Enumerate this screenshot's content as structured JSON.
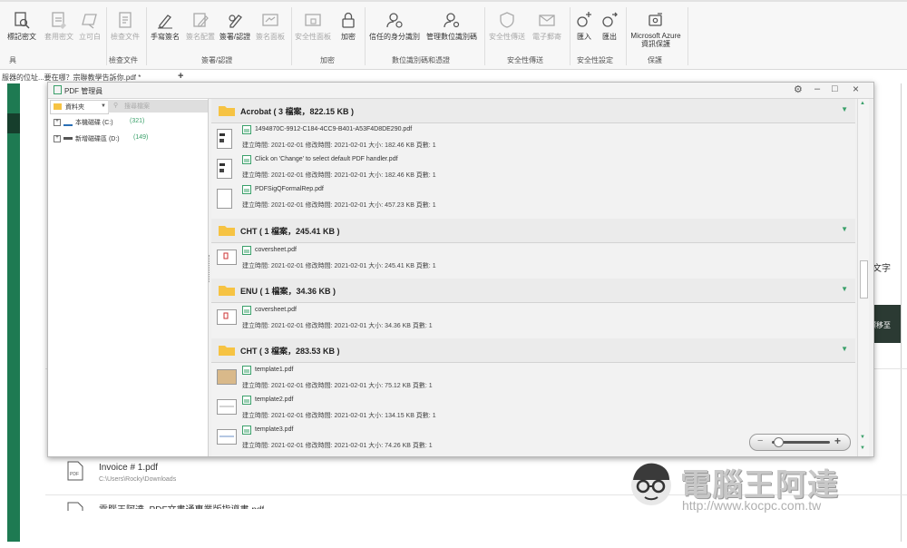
{
  "ribbon": {
    "buttons": [
      {
        "label": "標記密文",
        "icon": "mark-redact-icon",
        "disabled": false
      },
      {
        "label": "套用密文",
        "icon": "apply-redact-icon",
        "disabled": true
      },
      {
        "label": "立可白",
        "icon": "whiteout-icon",
        "disabled": true
      },
      {
        "label": "檢查文件",
        "icon": "inspect-document-icon",
        "disabled": true
      },
      {
        "label": "手寫簽名",
        "icon": "handwrite-sign-icon",
        "disabled": false
      },
      {
        "label": "簽名配置",
        "icon": "signature-config-icon",
        "disabled": true
      },
      {
        "label": "簽署/認證",
        "icon": "sign-certify-icon",
        "disabled": false
      },
      {
        "label": "簽名面板",
        "icon": "signature-panel-icon",
        "disabled": true
      },
      {
        "label": "安全性面板",
        "icon": "security-panel-icon",
        "disabled": true
      },
      {
        "label": "加密",
        "icon": "encrypt-icon",
        "disabled": false
      },
      {
        "label": "信任的身分識別",
        "icon": "trusted-identity-icon",
        "disabled": false
      },
      {
        "label": "管理數位識別碼",
        "icon": "manage-digital-id-icon",
        "disabled": false
      },
      {
        "label": "安全性傳送",
        "icon": "secure-send-icon",
        "disabled": true
      },
      {
        "label": "電子郵寄",
        "icon": "email-icon",
        "disabled": true
      },
      {
        "label": "匯入",
        "icon": "import-icon",
        "disabled": false
      },
      {
        "label": "匯出",
        "icon": "export-icon",
        "disabled": false
      },
      {
        "label": "Microsoft Azure",
        "label2": "資訊保護",
        "icon": "azure-protect-icon",
        "disabled": false
      }
    ],
    "groups": [
      "具",
      "檢查文件",
      "簽署/認證",
      "加密",
      "數位識別碼和憑證",
      "安全性傳送",
      "安全性設定",
      "保護"
    ]
  },
  "doc_tab": {
    "label": "服器的位址...要在哪？宗聯教學告訴你.pdf *",
    "add": "+"
  },
  "background": {
    "right_text": "文字",
    "right_dark_text": "標移至",
    "recent_files": [
      {
        "name": "Invoice # 1.pdf",
        "path": "C:\\Users\\Rocky\\Downloads"
      },
      {
        "name": "電腦王阿達_PDF文書通專業版指導書.pdf",
        "path": ""
      }
    ]
  },
  "pdf_manager": {
    "title": "PDF 管理員",
    "controls": {
      "settings": "⚙",
      "minimize": "–",
      "maximize": "□",
      "close": "×"
    },
    "left_tabs": {
      "folders": "資料夾",
      "search": "搜尋檔案"
    },
    "drives": [
      {
        "name": "本機磁碟 (C:)",
        "count": "(321)"
      },
      {
        "name": "新增磁碟區 (D:)",
        "count": "(149)"
      }
    ],
    "folders": [
      {
        "name": "Acrobat ( 3 檔案，822.15 KB )",
        "files": [
          {
            "name": "1494870C-9912-C184-4CC9-B401-A53F4D8DE290.pdf",
            "meta": "建立時間: 2021-02-01  修改時間: 2021-02-01  大小: 182.46 KB  頁數: 1"
          },
          {
            "name": "Click on 'Change' to select default PDF handler.pdf",
            "meta": "建立時間: 2021-02-01  修改時間: 2021-02-01  大小: 182.46 KB  頁數: 1"
          },
          {
            "name": "PDFSigQFormalRep.pdf",
            "meta": "建立時間: 2021-02-01  修改時間: 2021-02-01  大小: 457.23 KB  頁數: 1"
          }
        ]
      },
      {
        "name": "CHT ( 1 檔案，245.41 KB )",
        "files": [
          {
            "name": "coversheet.pdf",
            "meta": "建立時間: 2021-02-01  修改時間: 2021-02-01  大小: 245.41 KB  頁數: 1"
          }
        ]
      },
      {
        "name": "ENU ( 1 檔案，34.36 KB )",
        "files": [
          {
            "name": "coversheet.pdf",
            "meta": "建立時間: 2021-02-01  修改時間: 2021-02-01  大小: 34.36 KB  頁數: 1"
          }
        ]
      },
      {
        "name": "CHT ( 3 檔案，283.53 KB )",
        "files": [
          {
            "name": "template1.pdf",
            "meta": "建立時間: 2021-02-01  修改時間: 2021-02-01  大小: 75.12 KB  頁數: 1"
          },
          {
            "name": "template2.pdf",
            "meta": "建立時間: 2021-02-01  修改時間: 2021-02-01  大小: 134.15 KB  頁數: 1"
          },
          {
            "name": "template3.pdf",
            "meta": "建立時間: 2021-02-01  修改時間: 2021-02-01  大小: 74.26 KB  頁數: 1"
          }
        ]
      }
    ],
    "zoom": {
      "minus": "−",
      "plus": "+",
      "level": 0.1
    }
  },
  "watermark": {
    "title": "電腦王阿達",
    "url": "http://www.kocpc.com.tw"
  },
  "colors": {
    "green": "#1e7a52",
    "accent_green": "#3aa06a",
    "folder": "#f6c343"
  }
}
